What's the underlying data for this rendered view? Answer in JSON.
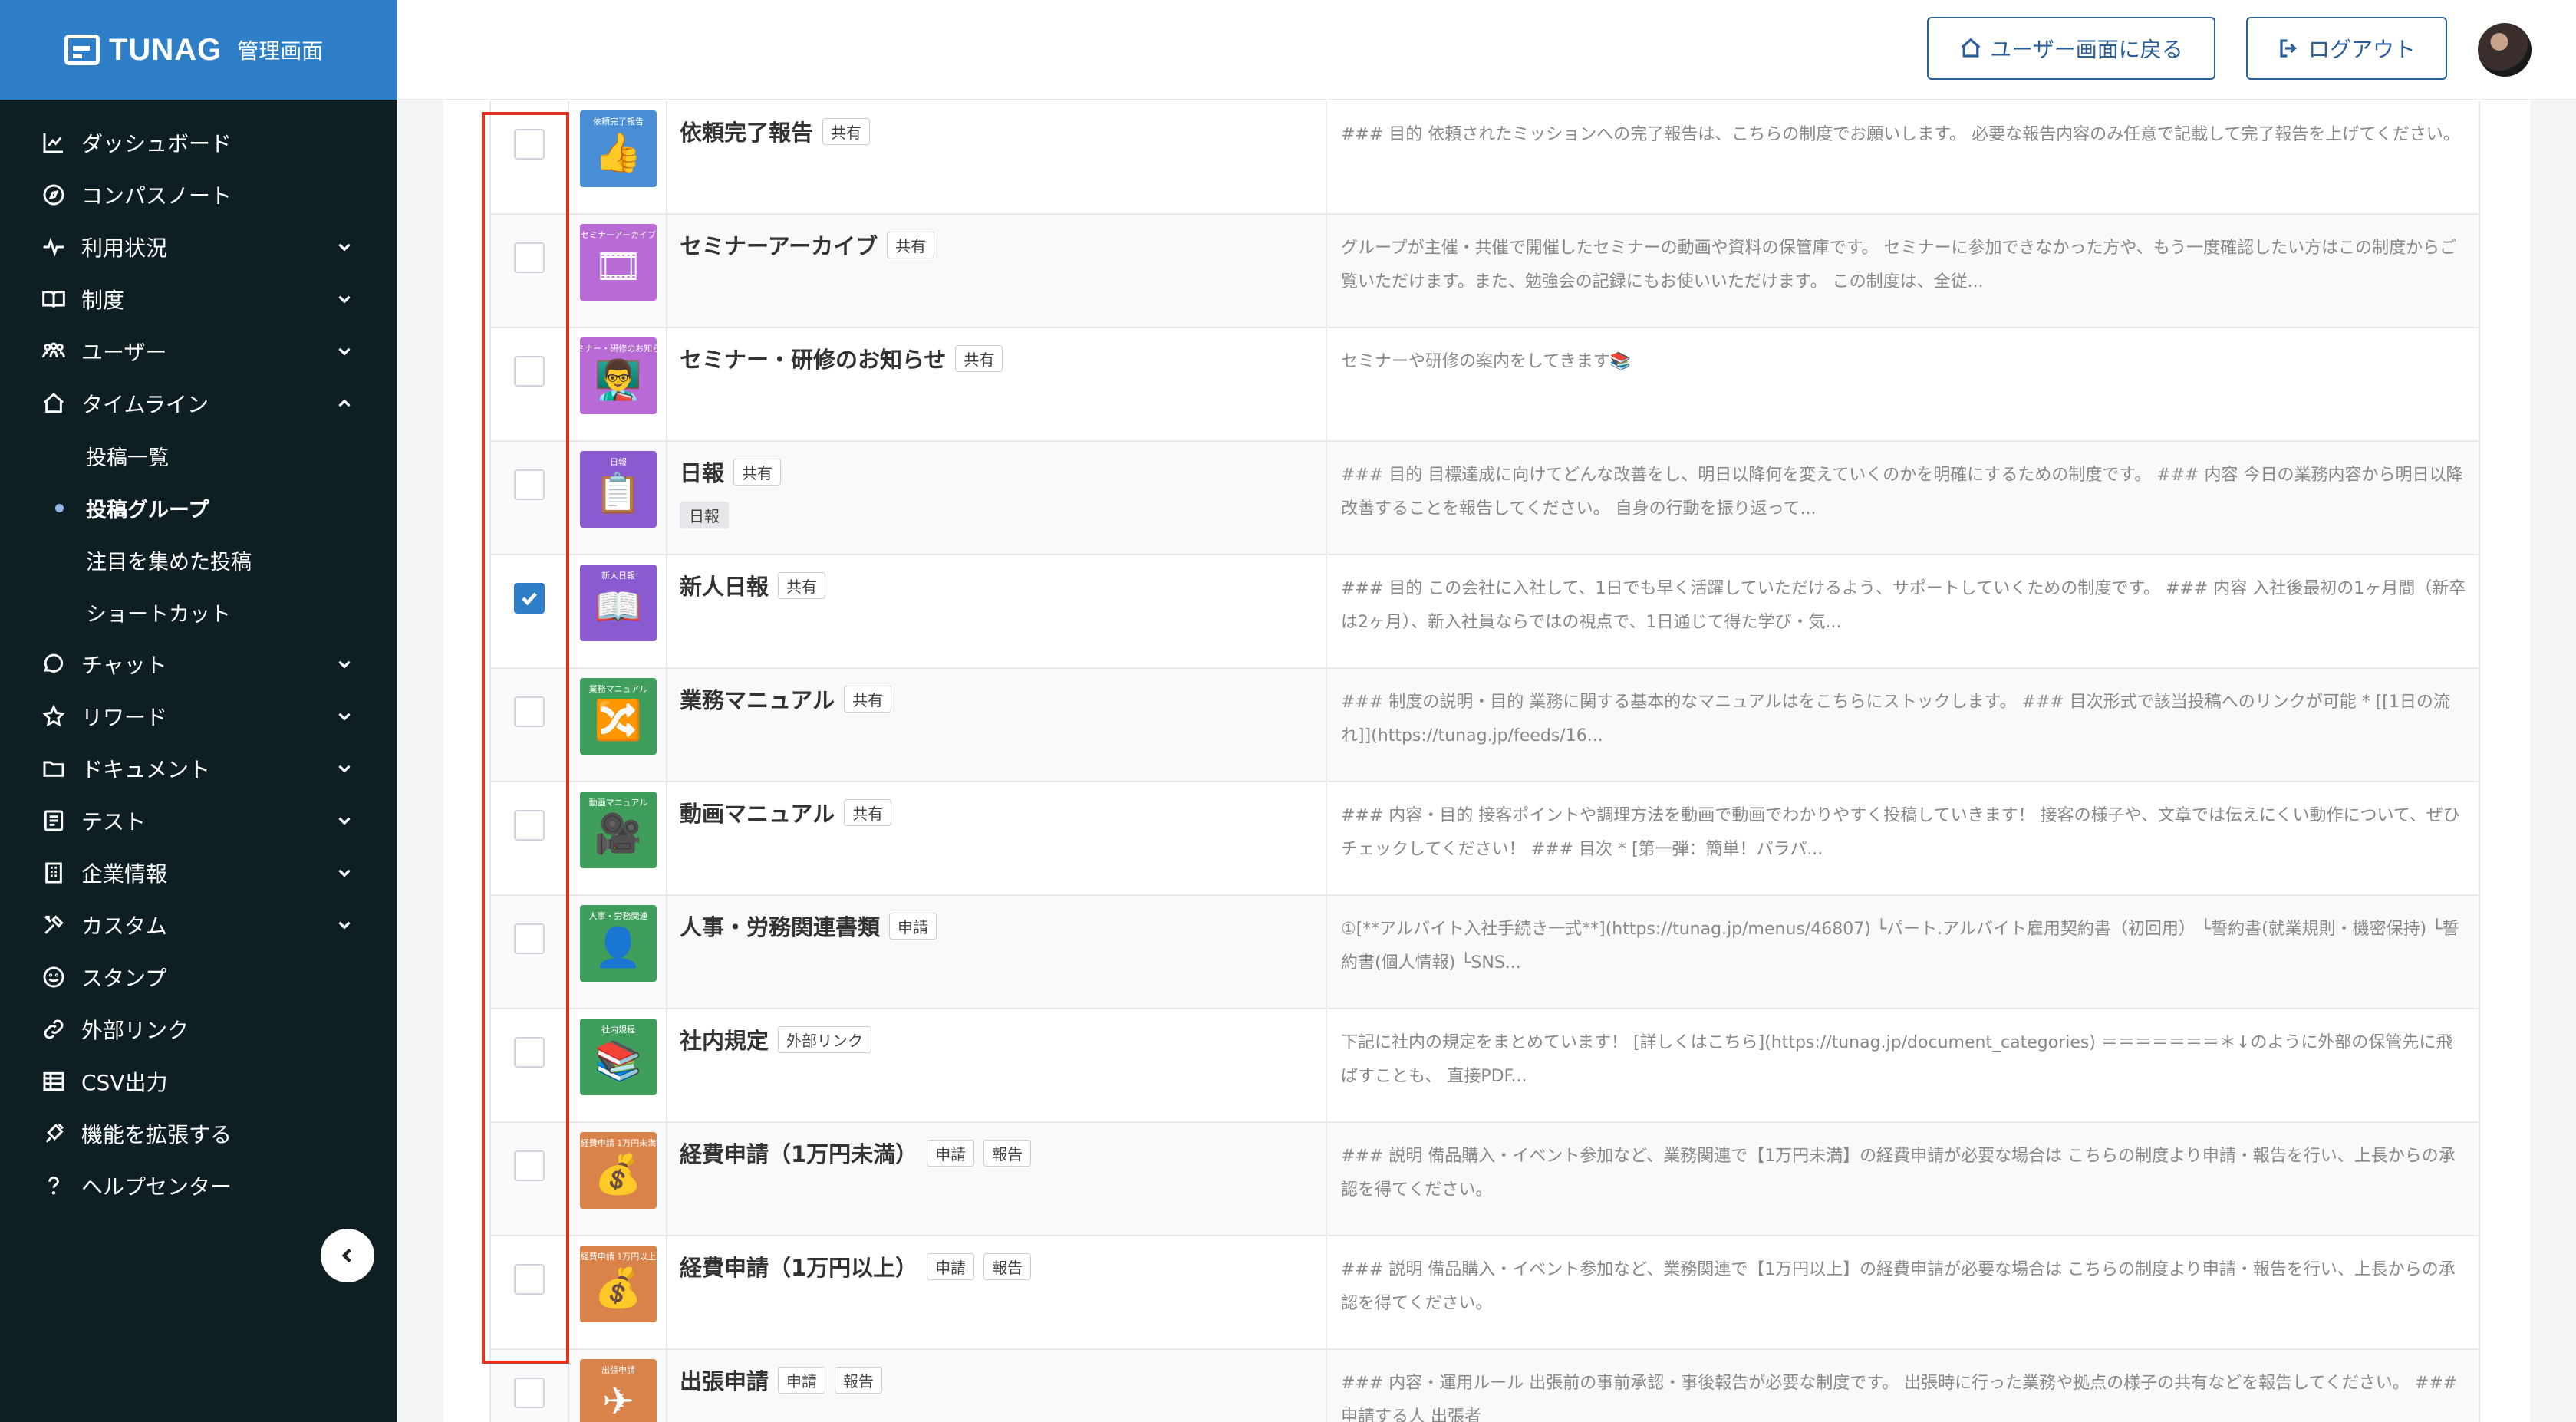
{
  "app": {
    "logo_text": "TUNAG",
    "logo_sub": "管理画面"
  },
  "header": {
    "user_screen_label": "ユーザー画面に戻る",
    "logout_label": "ログアウト"
  },
  "sidebar": {
    "items": [
      {
        "label": "ダッシュボード",
        "icon": "chart-line-icon"
      },
      {
        "label": "コンパスノート",
        "icon": "compass-icon"
      },
      {
        "label": "利用状況",
        "icon": "pulse-icon"
      },
      {
        "label": "制度",
        "icon": "book-icon"
      },
      {
        "label": "ユーザー",
        "icon": "users-icon"
      },
      {
        "label": "タイムライン",
        "icon": "home-icon"
      },
      {
        "label": "チャット",
        "icon": "chat-icon"
      },
      {
        "label": "リワード",
        "icon": "star-icon"
      },
      {
        "label": "ドキュメント",
        "icon": "folder-icon"
      },
      {
        "label": "テスト",
        "icon": "checklist-icon"
      },
      {
        "label": "企業情報",
        "icon": "building-icon"
      },
      {
        "label": "カスタム",
        "icon": "tools-icon"
      },
      {
        "label": "スタンプ",
        "icon": "smile-icon"
      },
      {
        "label": "外部リンク",
        "icon": "link-icon"
      },
      {
        "label": "CSV出力",
        "icon": "table-icon"
      },
      {
        "label": "機能を拡張する",
        "icon": "puzzle-icon"
      },
      {
        "label": "ヘルプセンター",
        "icon": "help-icon"
      }
    ],
    "timeline_sub": [
      "投稿一覧",
      "投稿グループ",
      "注目を集めた投稿",
      "ショートカット"
    ]
  },
  "colors": {
    "sidebar_bg": "#0e1f24",
    "brand_blue": "#2e7fc7",
    "highlight": "#e0321e"
  },
  "rows": [
    {
      "name": "依頼完了報告",
      "tags": [
        "共有"
      ],
      "thumb_label": "依頼完了報告",
      "thumb_color": "#4a8fd6",
      "thumb_glyph": "👍",
      "checked": false,
      "desc": "### 目的 依頼されたミッションへの完了報告は、こちらの制度でお願いします。 必要な報告内容のみ任意で記載して完了報告を上げてください。"
    },
    {
      "name": "セミナーアーカイブ",
      "tags": [
        "共有"
      ],
      "thumb_label": "セミナーアーカイブ",
      "thumb_color": "#b86bd6",
      "thumb_glyph": "🎞",
      "checked": false,
      "desc": "グループが主催・共催で開催したセミナーの動画や資料の保管庫です。 セミナーに参加できなかった方や、もう一度確認したい方はこの制度からご覧いただけます。また、勉強会の記録にもお使いいただけます。 この制度は、全従..."
    },
    {
      "name": "セミナー・研修のお知らせ",
      "tags": [
        "共有"
      ],
      "thumb_label": "セミナー・研修のお知らせ",
      "thumb_color": "#b86bd6",
      "thumb_glyph": "👨‍🏫",
      "checked": false,
      "desc": "セミナーや研修の案内をしてきます📚"
    },
    {
      "name": "日報",
      "tags": [
        "共有"
      ],
      "sub_tag": "日報",
      "thumb_label": "日報",
      "thumb_color": "#8a5bd0",
      "thumb_glyph": "📋",
      "checked": false,
      "desc": "### 目的 目標達成に向けてどんな改善をし、明日以降何を変えていくのかを明確にするための制度です。 ### 内容 今日の業務内容から明日以降改善することを報告してください。 自身の行動を振り返って..."
    },
    {
      "name": "新人日報",
      "tags": [
        "共有"
      ],
      "thumb_label": "新人日報",
      "thumb_color": "#8a5bd0",
      "thumb_glyph": "📖",
      "checked": true,
      "desc": "### 目的 この会社に入社して、1日でも早く活躍していただけるよう、サポートしていくための制度です。 ### 内容 入社後最初の1ヶ月間（新卒は2ヶ月）、新入社員ならではの視点で、1日通じて得た学び・気..."
    },
    {
      "name": "業務マニュアル",
      "tags": [
        "共有"
      ],
      "thumb_label": "業務マニュアル",
      "thumb_color": "#3f9e5b",
      "thumb_glyph": "🔀",
      "checked": false,
      "desc": "### 制度の説明・目的 業務に関する基本的なマニュアルはをこちらにストックします。 ### 目次形式で該当投稿へのリンクが可能 * [[1日の流れ]](https://tunag.jp/feeds/16..."
    },
    {
      "name": "動画マニュアル",
      "tags": [
        "共有"
      ],
      "thumb_label": "動画マニュアル",
      "thumb_color": "#3f9e5b",
      "thumb_glyph": "🎥",
      "checked": false,
      "desc": "### 内容・目的 接客ポイントや調理方法を動画で動画でわかりやすく投稿していきます！ 接客の様子や、文章では伝えにくい動作について、ぜひチェックしてください！ ### 目次 * [第一弾：簡単！パラパ..."
    },
    {
      "name": "人事・労務関連書類",
      "tags": [
        "申請"
      ],
      "thumb_label": "人事・労務関連",
      "thumb_color": "#3f9e5b",
      "thumb_glyph": "👤",
      "checked": false,
      "desc": "①[**アルバイト入社手続き一式**](https://tunag.jp/menus/46807) └パート.アルバイト雇用契約書（初回用） └誓約書(就業規則・機密保持) └誓約書(個人情報) └SNS..."
    },
    {
      "name": "社内規定",
      "tags": [
        "外部リンク"
      ],
      "thumb_label": "社内規程",
      "thumb_color": "#3f9e5b",
      "thumb_glyph": "📚",
      "checked": false,
      "desc": "下記に社内の規定をまとめています！ [詳しくはこちら](https://tunag.jp/document_categories) ＝＝＝＝＝＝＝＊↓のように外部の保管先に飛ばすことも、 直接PDF..."
    },
    {
      "name": "経費申請（1万円未満）",
      "tags": [
        "申請",
        "報告"
      ],
      "thumb_label": "経費申請 1万円未満",
      "thumb_color": "#d9824a",
      "thumb_glyph": "💰",
      "checked": false,
      "desc": "### 説明 備品購入・イベント参加など、業務関連で【1万円未満】の経費申請が必要な場合は こちらの制度より申請・報告を行い、上長からの承認を得てください。"
    },
    {
      "name": "経費申請（1万円以上）",
      "tags": [
        "申請",
        "報告"
      ],
      "thumb_label": "経費申請 1万円以上",
      "thumb_color": "#d9824a",
      "thumb_glyph": "💰",
      "checked": false,
      "desc": "### 説明 備品購入・イベント参加など、業務関連で【1万円以上】の経費申請が必要な場合は こちらの制度より申請・報告を行い、上長からの承認を得てください。"
    },
    {
      "name": "出張申請",
      "tags": [
        "申請",
        "報告"
      ],
      "thumb_label": "出張申請",
      "thumb_color": "#d9824a",
      "thumb_glyph": "✈",
      "checked": false,
      "desc": "### 内容・運用ルール 出張前の事前承認・事後報告が必要な制度です。 出張時に行った業務や拠点の様子の共有などを報告してください。 ### 申請する人 出張者"
    }
  ]
}
